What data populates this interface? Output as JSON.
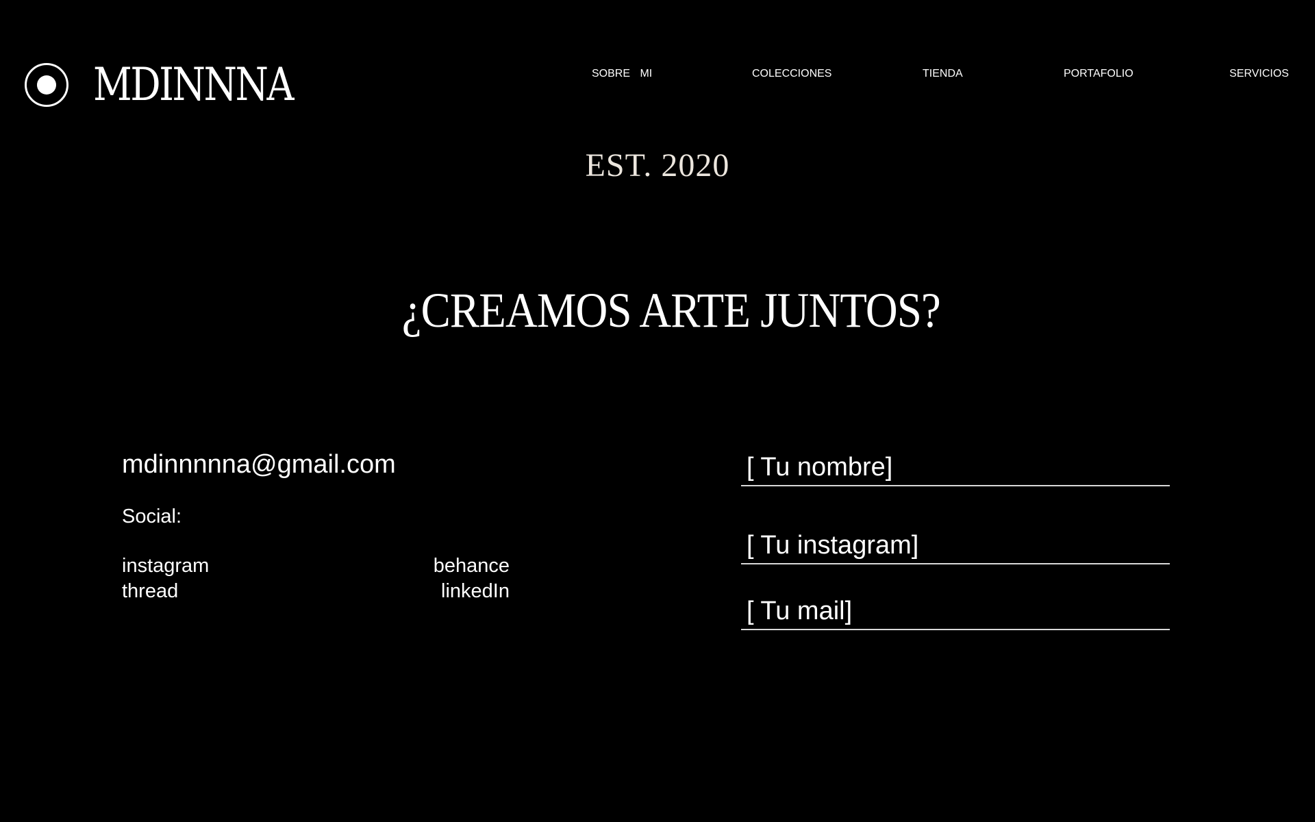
{
  "brand": {
    "name": "MDINNNA",
    "logo_icon": "circle-dot-icon"
  },
  "nav": {
    "items": [
      {
        "label": "SOBRE MI"
      },
      {
        "label": "COLECCIONES"
      },
      {
        "label": "TIENDA"
      },
      {
        "label": "PORTAFOLIO"
      },
      {
        "label": "SERVICIOS"
      }
    ]
  },
  "hero": {
    "established": "EST. 2020",
    "headline": "¿CREAMOS ARTE JUNTOS?"
  },
  "contact": {
    "email": "mdinnnnna@gmail.com",
    "social_label": "Social:",
    "social_links": [
      {
        "label": "instagram"
      },
      {
        "label": "thread"
      },
      {
        "label": "behance"
      },
      {
        "label": "linkedIn"
      }
    ]
  },
  "form": {
    "name_placeholder": "[ Tu nombre]",
    "instagram_placeholder": "[ Tu instagram]",
    "mail_placeholder": "[ Tu mail]"
  },
  "colors": {
    "background": "#000000",
    "text": "#ffffff",
    "accent_text": "#ece6de"
  }
}
